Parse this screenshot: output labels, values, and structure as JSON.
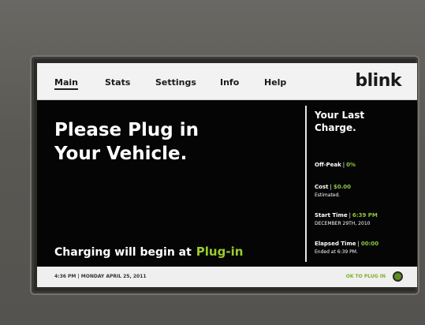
{
  "nav": {
    "tabs": [
      {
        "label": "Main"
      },
      {
        "label": "Stats"
      },
      {
        "label": "Settings"
      },
      {
        "label": "Info"
      },
      {
        "label": "Help"
      }
    ],
    "logo": "blink"
  },
  "main": {
    "headline_line1": "Please Plug in",
    "headline_line2": "Your Vehicle.",
    "footer_text": "Charging will begin at",
    "footer_highlight": "Plug-in"
  },
  "last_charge": {
    "title_line1": "Your Last",
    "title_line2": "Charge.",
    "off_peak": {
      "label": "Off-Peak",
      "value": "0%"
    },
    "cost": {
      "label": "Cost",
      "value": "$0.00",
      "note": "Estimated."
    },
    "start_time": {
      "label": "Start Time",
      "value": "6:39 PM",
      "date": "DECEMBER 29TH, 2010"
    },
    "elapsed_time": {
      "label": "Elapsed Time",
      "value": "00:00",
      "note": "Ended at 6:39 PM."
    }
  },
  "statusbar": {
    "datetime": "4:36 PM | MONDAY APRIL 25, 2011",
    "status": "OK TO PLUG IN"
  },
  "colors": {
    "accent": "#8dc63f",
    "screen_bg": "#050505",
    "bar_bg": "#f2f2f2"
  }
}
